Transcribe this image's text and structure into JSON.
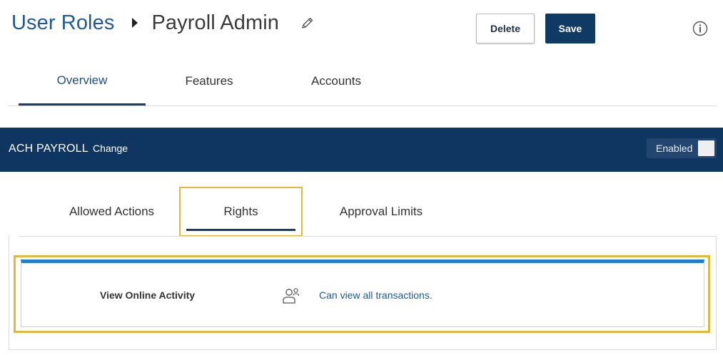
{
  "header": {
    "breadcrumb_root": "User Roles",
    "title": "Payroll Admin",
    "delete_label": "Delete",
    "save_label": "Save"
  },
  "main_tabs": [
    {
      "label": "Overview",
      "active": true
    },
    {
      "label": "Features",
      "active": false
    },
    {
      "label": "Accounts",
      "active": false
    }
  ],
  "banner": {
    "title": "ACH PAYROLL",
    "change_label": "Change",
    "toggle_label": "Enabled"
  },
  "sub_tabs": [
    {
      "label": "Allowed Actions",
      "active": false
    },
    {
      "label": "Rights",
      "active": true
    },
    {
      "label": "Approval Limits",
      "active": false
    }
  ],
  "rights": [
    {
      "name": "View Online Activity",
      "icon": "users-icon",
      "description": "Can view all transactions."
    }
  ],
  "icons": {
    "breadcrumb_separator": "caret-right-icon",
    "edit": "pencil-icon",
    "info": "info-icon"
  },
  "colors": {
    "brand_navy": "#0f3660",
    "link_blue": "#1f5a96",
    "highlight_yellow": "#e4b93a",
    "card_accent": "#1e7fd0"
  }
}
